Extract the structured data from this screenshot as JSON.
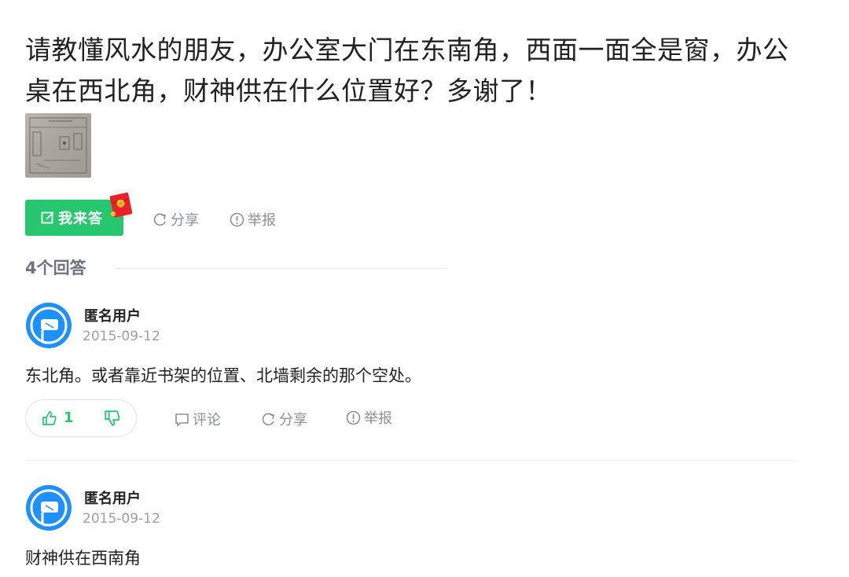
{
  "question": {
    "title": "请教懂风水的朋友，办公室大门在东南角，西面一面全是窗，办公桌在西北角，财神供在什么位置好？多谢了！"
  },
  "actions": {
    "answer_button": "我来答",
    "share": "分享",
    "report": "举报"
  },
  "answers_header": {
    "count_label": "4个回答"
  },
  "answers": [
    {
      "username": "匿名用户",
      "date": "2015-09-12",
      "text": "东北角。或者靠近书架的位置、北墙剩余的那个空处。",
      "likes": "1",
      "comment": "评论",
      "share": "分享",
      "report": "举报"
    },
    {
      "username": "匿名用户",
      "date": "2015-09-12",
      "text": "财神供在西南角"
    }
  ],
  "colors": {
    "accent_green": "#28c76f",
    "muted_text": "#8a8f99",
    "avatar_blue": "#1e90ff",
    "envelope_red": "#e8212b"
  }
}
